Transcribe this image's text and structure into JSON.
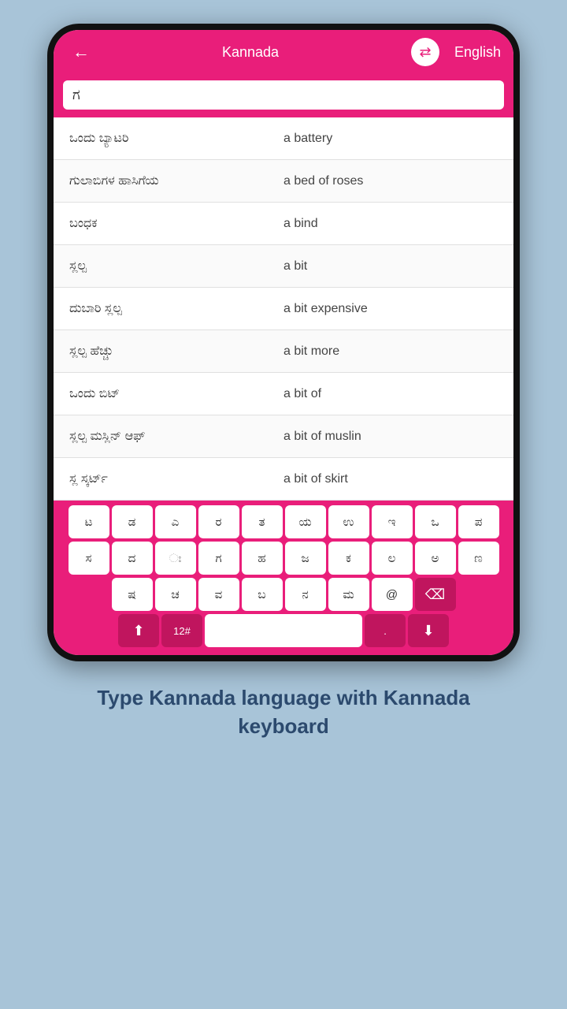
{
  "header": {
    "back_label": "←",
    "title": "Kannada",
    "swap_icon": "⇄",
    "lang_label": "English"
  },
  "search": {
    "value": "ಗ",
    "placeholder": ""
  },
  "results": [
    {
      "kannada": "ಒಂದು ಬ್ಯಾಟರಿ",
      "english": "a battery"
    },
    {
      "kannada": "ಗುಲಾಬಿಗಳ ಹಾಸಿಗೆಯ",
      "english": "a bed of roses"
    },
    {
      "kannada": "ಬಂಧಕ",
      "english": "a bind"
    },
    {
      "kannada": "ಸ್ಲಲ್ಪ",
      "english": "a bit"
    },
    {
      "kannada": "ದುಬಾರಿ ಸ್ಲಲ್ಪ",
      "english": "a bit expensive"
    },
    {
      "kannada": "ಸ್ಲಲ್ಪ ಹೆಚ್ಚು",
      "english": "a bit more"
    },
    {
      "kannada": "ಒಂದು ಬಿಟ್",
      "english": "a bit of"
    },
    {
      "kannada": "ಸ್ಲಲ್ಪ ಮಸ್ಲಿನ್ ಆಫ್",
      "english": "a bit of muslin"
    },
    {
      "kannada": "ಸ್ಲ ಸ್ಕರ್ಟ್",
      "english": "a bit of skirt"
    }
  ],
  "keyboard": {
    "row1": [
      "ಟ",
      "ಡ",
      "ಎ",
      "ರ",
      "ತ",
      "ಯ",
      "ಉ",
      "ಇ",
      "ಒ",
      "ಪ"
    ],
    "row2": [
      "ಸ",
      "ದ",
      "ಃ",
      "ಗ",
      "ಹ",
      "ಜ",
      "ಕ",
      "ಲ",
      "ಅ",
      "ಣ"
    ],
    "row3": [
      "ಷ",
      "ಚ",
      "ವ",
      "ಬ",
      "ನ",
      "ಮ",
      "@"
    ],
    "row4_num": "12#",
    "row4_dot": ".",
    "shift_icon": "⬆",
    "backspace_icon": "⌫",
    "down_icon": "⬇"
  },
  "caption": "Type Kannada language with Kannada keyboard"
}
